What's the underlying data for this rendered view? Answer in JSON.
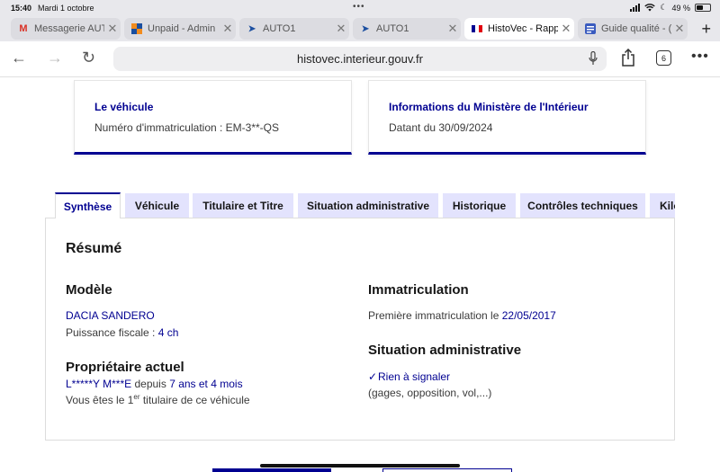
{
  "status": {
    "time": "15:40",
    "date": "Mardi 1 octobre",
    "battery": "49 %",
    "battery_level": 0.49
  },
  "browser_tabs": [
    {
      "label": "Messagerie AUT",
      "icon": "gmail-icon",
      "active": false
    },
    {
      "label": "Unpaid - Admin",
      "icon": "unpaid-icon",
      "active": false
    },
    {
      "label": "AUTO1",
      "icon": "auto1-icon",
      "active": false
    },
    {
      "label": "AUTO1",
      "icon": "auto1-icon",
      "active": false
    },
    {
      "label": "HistoVec - Rapp",
      "icon": "french-flag-icon",
      "active": true
    },
    {
      "label": "Guide qualité - (",
      "icon": "guide-icon",
      "active": false
    }
  ],
  "address_bar": {
    "url": "histovec.interieur.gouv.fr",
    "tab_count": "6"
  },
  "cards": {
    "vehicle": {
      "title": "Le véhicule",
      "text": "Numéro d'immatriculation : EM-3**-QS"
    },
    "ministry": {
      "title": "Informations du Ministère de l'Intérieur",
      "text": "Datant du 30/09/2024"
    }
  },
  "page_tabs": [
    {
      "label": "Synthèse",
      "active": true
    },
    {
      "label": "Véhicule",
      "active": false
    },
    {
      "label": "Titulaire et Titre",
      "active": false
    },
    {
      "label": "Situation administrative",
      "active": false
    },
    {
      "label": "Historique",
      "active": false
    },
    {
      "label": "Contrôles techniques",
      "active": false
    },
    {
      "label": "Kilo",
      "active": false
    }
  ],
  "summary": {
    "title": "Résumé",
    "model": {
      "heading": "Modèle",
      "name": "DACIA SANDERO",
      "fiscal_label": "Puissance fiscale : ",
      "fiscal_value": "4 ch"
    },
    "owner": {
      "heading": "Propriétaire actuel",
      "name": "L*****Y M***E",
      "since_label": " depuis ",
      "since_value": "7 ans et 4 mois",
      "rank_prefix": "Vous êtes le 1",
      "rank_sup": "er",
      "rank_suffix": " titulaire de ce véhicule"
    },
    "registration": {
      "heading": "Immatriculation",
      "label": "Première immatriculation le ",
      "date": "22/05/2017"
    },
    "admin": {
      "heading": "Situation administrative",
      "status": "Rien à signaler",
      "detail": "(gages, opposition, vol,...)"
    }
  },
  "colors": {
    "accent": "#000091",
    "tab_bg": "#e3e3fd"
  }
}
